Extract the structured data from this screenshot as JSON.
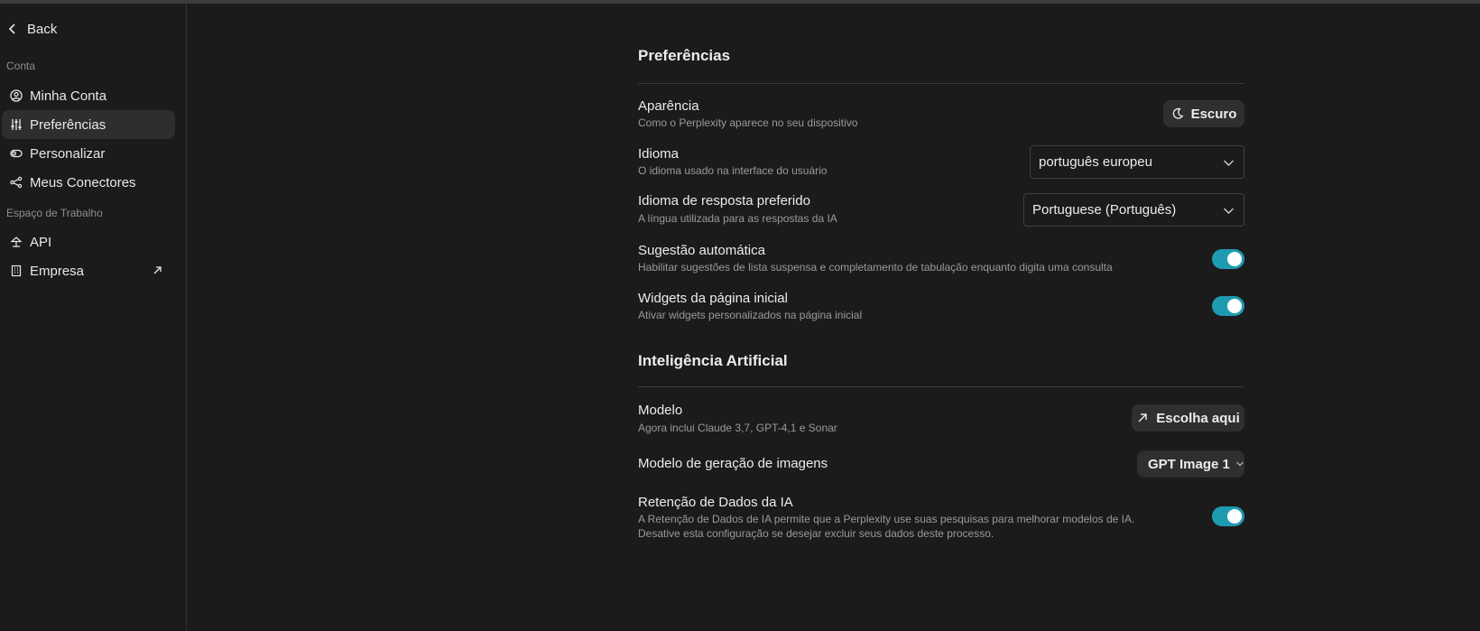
{
  "sidebar": {
    "back_label": "Back",
    "section_account": "Conta",
    "section_workspace": "Espaço de Trabalho",
    "items": [
      {
        "label": "Minha Conta",
        "icon": "user-circle-icon"
      },
      {
        "label": "Preferências",
        "icon": "sliders-icon",
        "active": true
      },
      {
        "label": "Personalizar",
        "icon": "toggle-icon"
      },
      {
        "label": "Meus Conectores",
        "icon": "connectors-icon"
      },
      {
        "label": "API",
        "icon": "api-icon"
      },
      {
        "label": "Empresa",
        "icon": "building-icon",
        "external": true
      }
    ]
  },
  "preferences": {
    "heading": "Preferências",
    "appearance": {
      "title": "Aparência",
      "desc": "Como o Perplexity aparece no seu dispositivo",
      "button": "Escuro"
    },
    "language": {
      "title": "Idioma",
      "desc": "O idioma usado na interface do usuário",
      "value": "português europeu"
    },
    "response_language": {
      "title": "Idioma de resposta preferido",
      "desc": "A língua utilizada para as respostas da IA",
      "value": "Portuguese (Português)"
    },
    "autosuggest": {
      "title": "Sugestão automática",
      "desc": "Habilitar sugestões de lista suspensa e completamento de tabulação enquanto digita uma consulta",
      "enabled": true
    },
    "widgets": {
      "title": "Widgets da página inicial",
      "desc": "Ativar widgets personalizados na página inicial",
      "enabled": true
    }
  },
  "ai": {
    "heading": "Inteligência Artificial",
    "model": {
      "title": "Modelo",
      "desc": "Agora inclui Claude 3,7, GPT-4,1 e Sonar",
      "button": "Escolha aqui"
    },
    "image_model": {
      "title": "Modelo de geração de imagens",
      "value": "GPT Image 1"
    },
    "retention": {
      "title": "Retenção de Dados da IA",
      "desc_line1": "A Retenção de Dados de IA permite que a Perplexity use suas pesquisas para melhorar modelos de IA.",
      "desc_line2": "Desative esta configuração se desejar excluir seus dados deste processo.",
      "enabled": true
    }
  },
  "colors": {
    "background": "#1b1b1b",
    "toggle_on": "#1e9bb1",
    "button_bg": "#2f2f2f"
  }
}
